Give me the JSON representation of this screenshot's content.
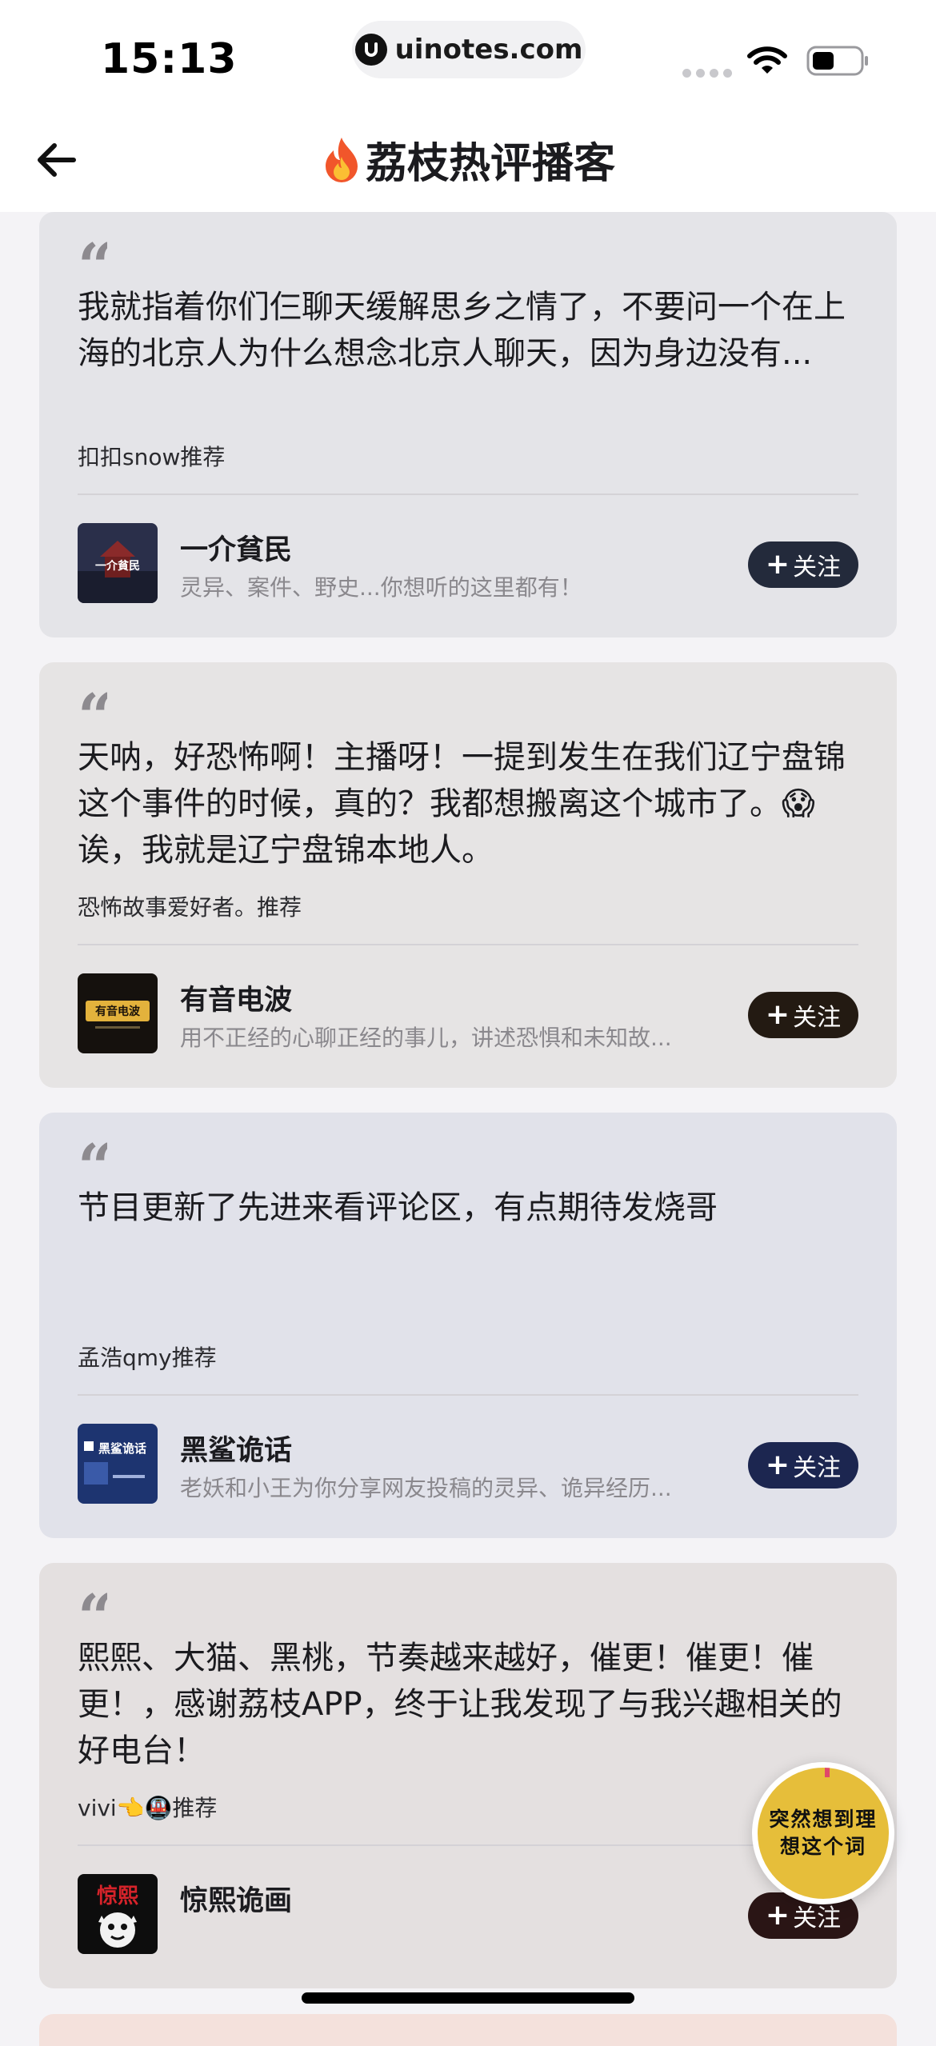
{
  "status_bar": {
    "time": "15:13",
    "url": "uinotes.com"
  },
  "nav": {
    "title": "荔枝热评播客"
  },
  "cards": [
    {
      "comment": "我就指着你们仨聊天缓解思乡之情了，不要问一个在上海的北京人为什么想念北京人聊天，因为身边没有...",
      "recommender": "扣扣snow推荐",
      "podcast_name": "一介貧民",
      "podcast_desc": "灵异、案件、野史...你想听的这里都有！",
      "cover_text": "一介貧民",
      "follow_label": "关注",
      "bg_color": "#e4e4e8",
      "button_color": "#232a3b"
    },
    {
      "comment": "天呐，好恐怖啊！主播呀！一提到发生在我们辽宁盘锦这个事件的时候，真的？我都想搬离这个城市了。😱诶，我就是辽宁盘锦本地人。",
      "recommender": "恐怖故事爱好者。推荐",
      "podcast_name": "有音电波",
      "podcast_desc": "用不正经的心聊正经的事儿，讲述恐惧和未知故...",
      "cover_text": "有音电波",
      "follow_label": "关注",
      "bg_color": "#e6e4e4",
      "button_color": "#231a12"
    },
    {
      "comment": "节目更新了先进来看评论区，有点期待发烧哥",
      "recommender": "孟浩qmy推荐",
      "podcast_name": "黑鲨诡话",
      "podcast_desc": "老妖和小王为你分享网友投稿的灵异、诡异经历...",
      "cover_text": "黑鲨诡话",
      "follow_label": "关注",
      "bg_color": "#e1e2ea",
      "button_color": "#1c2650"
    },
    {
      "comment": "熙熙、大猫、黑桃，节奏越来越好，催更！催更！催更！，感谢荔枝APP，终于让我发现了与我兴趣相关的好电台！",
      "recommender": "vivi👈🚇推荐",
      "podcast_name": "惊熙诡画",
      "podcast_desc": "",
      "cover_text": "惊熙",
      "follow_label": "关注",
      "bg_color": "#e4e0e0",
      "button_color": "#2a1515"
    }
  ],
  "float_badge": {
    "text": "突然想到理想这个词"
  },
  "icons": {
    "back": "arrow-left-icon",
    "fire": "fire-icon",
    "wifi": "wifi-icon",
    "battery": "battery-icon",
    "quote": "quote-icon",
    "plus": "plus-icon"
  }
}
